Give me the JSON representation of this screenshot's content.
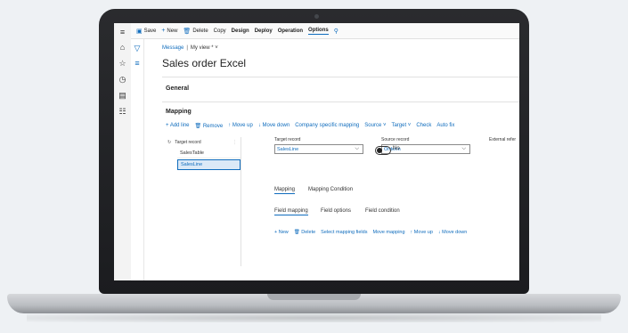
{
  "command_bar": {
    "items": [
      {
        "icon": "save-icon",
        "label": "Save"
      },
      {
        "icon": "plus-icon",
        "label": "New"
      },
      {
        "icon": "trash-icon",
        "label": "Delete"
      },
      {
        "icon": "",
        "label": "Copy"
      },
      {
        "icon": "",
        "label": "Design"
      },
      {
        "icon": "",
        "label": "Deploy"
      },
      {
        "icon": "",
        "label": "Operation"
      },
      {
        "icon": "",
        "label": "Options"
      }
    ]
  },
  "breadcrumb": {
    "message": "Message",
    "separator": "|",
    "view": "My view * ˅"
  },
  "page": {
    "title": "Sales order Excel"
  },
  "sections": {
    "general": "General",
    "mapping": "Mapping"
  },
  "mapping_toolbar": [
    "+ Add line",
    "Remove",
    "↑ Move up",
    "↓ Move down",
    "Company specific mapping",
    "Source ˅",
    "Target ˅",
    "Check",
    "Auto fix"
  ],
  "grid": {
    "header": "Target record",
    "rows": [
      "SalesTable",
      "SalesLine"
    ]
  },
  "fields": {
    "target_record_label": "Target record",
    "target_record_value": "SalesLine",
    "source_record_label": "Source record",
    "source_record_value": "OrderIn",
    "external_label": "External refer",
    "toggle_value": "No"
  },
  "tabs": {
    "mapping": "Mapping",
    "mapping_condition": "Mapping Condition"
  },
  "subtabs": {
    "field_mapping": "Field mapping",
    "field_options": "Field options",
    "field_condition": "Field condition"
  },
  "field_toolbar": [
    "+ New",
    "Delete",
    "Select mapping fields",
    "Move mapping",
    "↑ Move up",
    "↓ Move down"
  ],
  "colors": {
    "accent": "#0f6cbd"
  }
}
